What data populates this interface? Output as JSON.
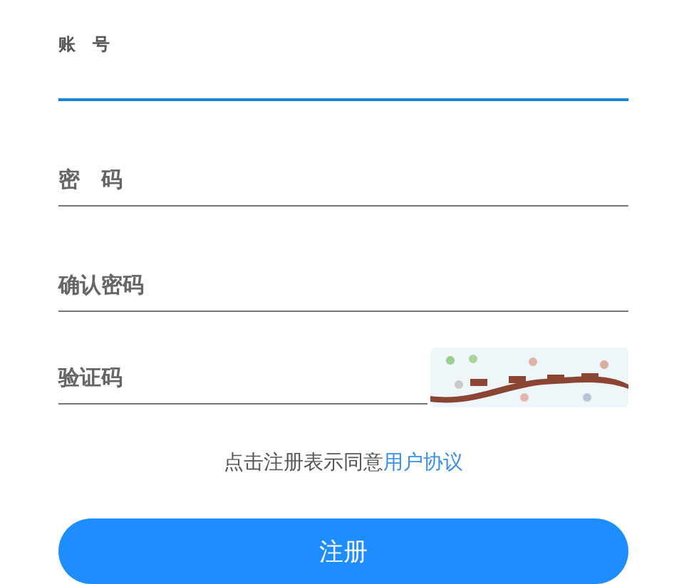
{
  "fields": [
    {
      "label": "账　号",
      "focused": true
    },
    {
      "label": "密　码",
      "focused": false
    },
    {
      "label": "确认密码",
      "focused": false
    }
  ],
  "captcha": {
    "label": "验证码",
    "focused": false
  },
  "agreement": {
    "text": "点击注册表示同意",
    "link": "用户协议"
  },
  "submit": {
    "label": "注册"
  }
}
